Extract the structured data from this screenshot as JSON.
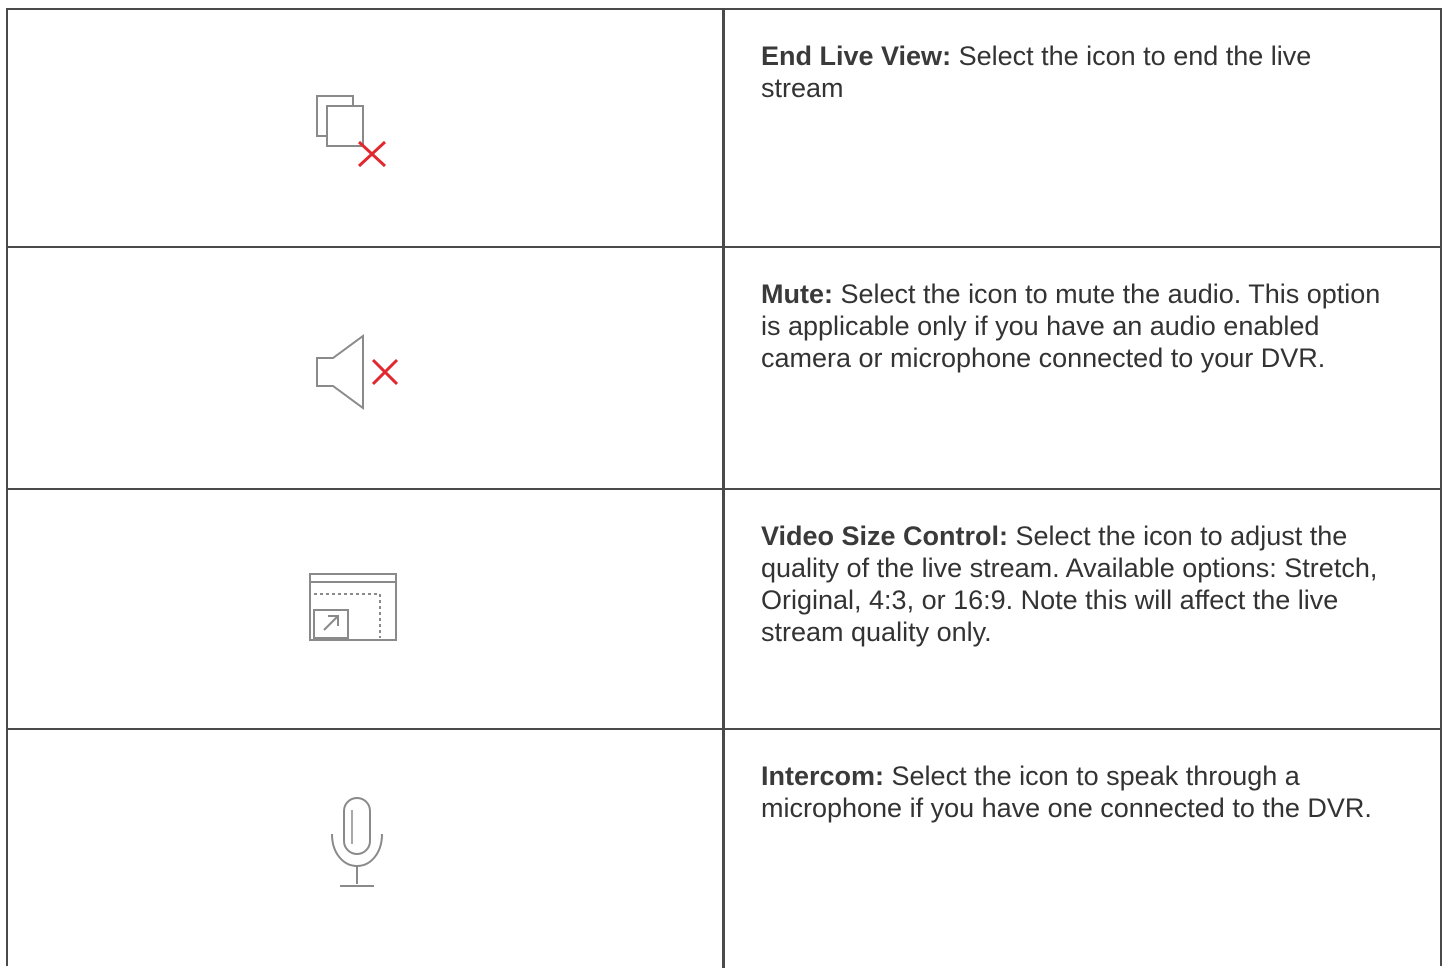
{
  "rows": [
    {
      "icon": "end-live-view-icon",
      "title": "End Live View:",
      "description": " Select the icon to end the live stream"
    },
    {
      "icon": "mute-icon",
      "title": "Mute:",
      "description": " Select the icon to mute the audio. This option is applicable only if you have an audio enabled camera or microphone connected to your DVR."
    },
    {
      "icon": "video-size-control-icon",
      "title": "Video Size Control:",
      "description": " Select the icon to adjust the quality of the live stream. Available options: Stretch, Original, 4:3, or 16:9. Note this will affect the live stream quality only."
    },
    {
      "icon": "microphone-icon",
      "title": "Intercom:",
      "description": " Select the icon to speak through a microphone if you have one connected to the DVR."
    }
  ],
  "colors": {
    "icon_gray": "#8a8a8a",
    "icon_red": "#e0282e",
    "border": "#4a4a4a",
    "text": "#333333"
  }
}
